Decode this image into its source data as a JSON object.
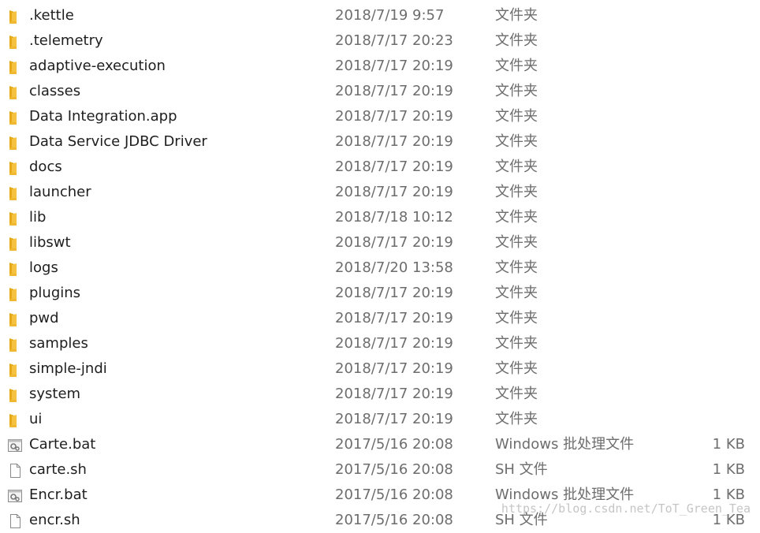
{
  "files": [
    {
      "name": ".kettle",
      "date": "2018/7/19 9:57",
      "type": "文件夹",
      "size": "",
      "icon": "folder-icon"
    },
    {
      "name": ".telemetry",
      "date": "2018/7/17 20:23",
      "type": "文件夹",
      "size": "",
      "icon": "folder-icon"
    },
    {
      "name": "adaptive-execution",
      "date": "2018/7/17 20:19",
      "type": "文件夹",
      "size": "",
      "icon": "folder-icon"
    },
    {
      "name": "classes",
      "date": "2018/7/17 20:19",
      "type": "文件夹",
      "size": "",
      "icon": "folder-icon"
    },
    {
      "name": "Data Integration.app",
      "date": "2018/7/17 20:19",
      "type": "文件夹",
      "size": "",
      "icon": "folder-icon"
    },
    {
      "name": "Data Service JDBC Driver",
      "date": "2018/7/17 20:19",
      "type": "文件夹",
      "size": "",
      "icon": "folder-icon"
    },
    {
      "name": "docs",
      "date": "2018/7/17 20:19",
      "type": "文件夹",
      "size": "",
      "icon": "folder-icon"
    },
    {
      "name": "launcher",
      "date": "2018/7/17 20:19",
      "type": "文件夹",
      "size": "",
      "icon": "folder-icon"
    },
    {
      "name": "lib",
      "date": "2018/7/18 10:12",
      "type": "文件夹",
      "size": "",
      "icon": "folder-icon"
    },
    {
      "name": "libswt",
      "date": "2018/7/17 20:19",
      "type": "文件夹",
      "size": "",
      "icon": "folder-icon"
    },
    {
      "name": "logs",
      "date": "2018/7/20 13:58",
      "type": "文件夹",
      "size": "",
      "icon": "folder-icon"
    },
    {
      "name": "plugins",
      "date": "2018/7/17 20:19",
      "type": "文件夹",
      "size": "",
      "icon": "folder-icon"
    },
    {
      "name": "pwd",
      "date": "2018/7/17 20:19",
      "type": "文件夹",
      "size": "",
      "icon": "folder-icon"
    },
    {
      "name": "samples",
      "date": "2018/7/17 20:19",
      "type": "文件夹",
      "size": "",
      "icon": "folder-icon"
    },
    {
      "name": "simple-jndi",
      "date": "2018/7/17 20:19",
      "type": "文件夹",
      "size": "",
      "icon": "folder-icon"
    },
    {
      "name": "system",
      "date": "2018/7/17 20:19",
      "type": "文件夹",
      "size": "",
      "icon": "folder-icon"
    },
    {
      "name": "ui",
      "date": "2018/7/17 20:19",
      "type": "文件夹",
      "size": "",
      "icon": "folder-icon"
    },
    {
      "name": "Carte.bat",
      "date": "2017/5/16 20:08",
      "type": "Windows 批处理文件",
      "size": "1 KB",
      "icon": "batch-file-icon"
    },
    {
      "name": "carte.sh",
      "date": "2017/5/16 20:08",
      "type": "SH 文件",
      "size": "1 KB",
      "icon": "blank-file-icon"
    },
    {
      "name": "Encr.bat",
      "date": "2017/5/16 20:08",
      "type": "Windows 批处理文件",
      "size": "1 KB",
      "icon": "batch-file-icon"
    },
    {
      "name": "encr.sh",
      "date": "2017/5/16 20:08",
      "type": "SH 文件",
      "size": "1 KB",
      "icon": "blank-file-icon"
    }
  ],
  "watermark": "https://blog.csdn.net/ToT_Green_Tea",
  "colors": {
    "folder": "#f5c242",
    "folder_dark": "#e6a817",
    "text": "#1e1e1e",
    "muted_text": "#6d6d6d"
  }
}
